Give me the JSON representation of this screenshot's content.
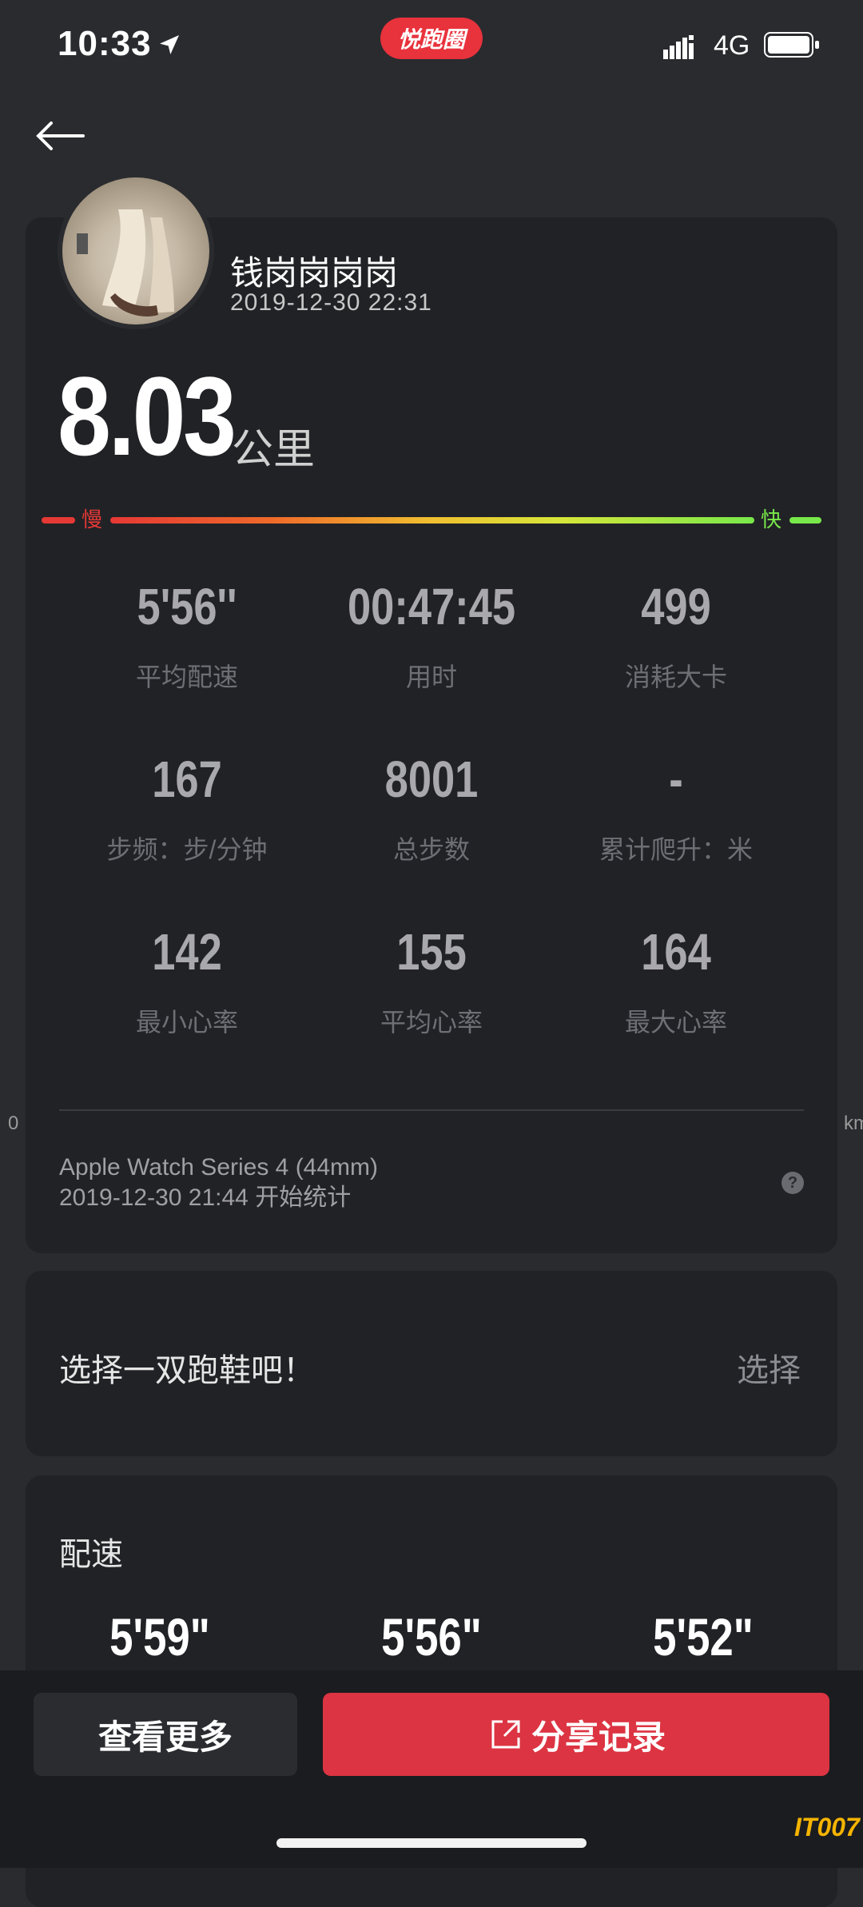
{
  "status_bar": {
    "time": "10:33",
    "app_badge": "悦跑圈",
    "network": "4G"
  },
  "profile": {
    "username": "钱岗岗岗岗",
    "datetime": "2019-12-30 22:31"
  },
  "summary": {
    "distance": "8.03",
    "unit": "公里"
  },
  "speed_scale": {
    "slow_label": "慢",
    "fast_label": "快"
  },
  "stats": [
    {
      "value": "5'56''",
      "label": "平均配速"
    },
    {
      "value": "00:47:45",
      "label": "用时"
    },
    {
      "value": "499",
      "label": "消耗大卡"
    },
    {
      "value": "167",
      "label": "步频：步/分钟"
    },
    {
      "value": "8001",
      "label": "总步数"
    },
    {
      "value": "-",
      "label": "累计爬升：米"
    },
    {
      "value": "142",
      "label": "最小心率"
    },
    {
      "value": "155",
      "label": "平均心率"
    },
    {
      "value": "164",
      "label": "最大心率"
    }
  ],
  "map_edge": {
    "left_label": "0",
    "right_label": "km"
  },
  "device": {
    "name": "Apple Watch Series 4 (44mm)",
    "start": "2019-12-30 21:44 开始统计"
  },
  "shoe": {
    "prompt": "选择一双跑鞋吧！",
    "action": "选择"
  },
  "pace": {
    "title": "配速",
    "values": [
      "5'59\"",
      "5'56\"",
      "5'52\""
    ]
  },
  "actions": {
    "more": "查看更多",
    "share": "分享记录"
  },
  "watermark": "IT007"
}
